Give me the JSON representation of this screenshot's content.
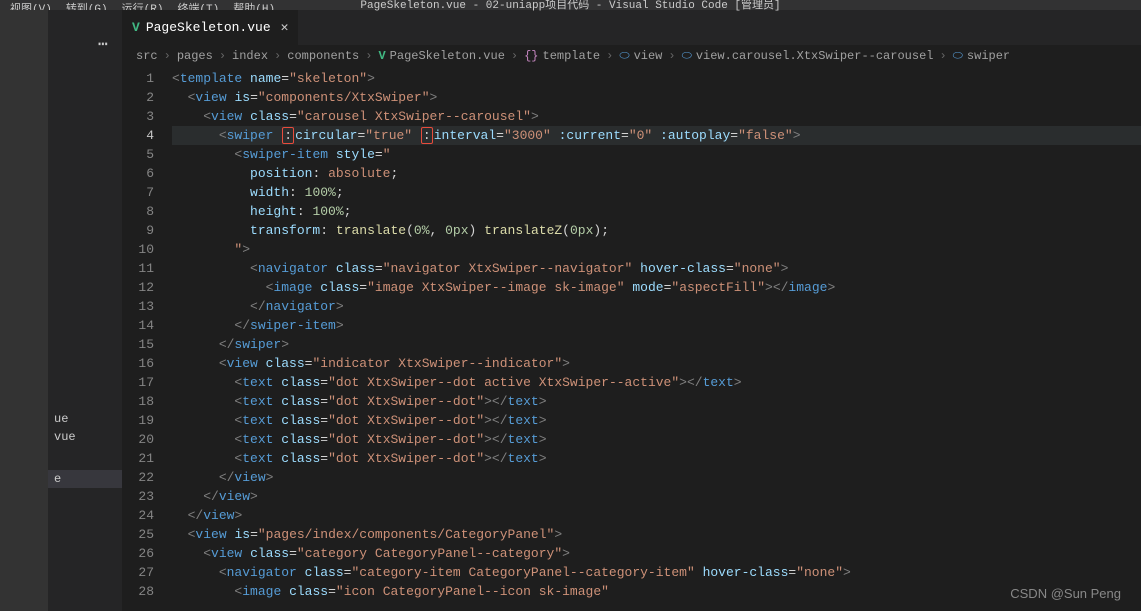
{
  "title": "PageSkeleton.vue - 02-uniapp项目代码 - Visual Studio Code [管理员]",
  "menu": [
    "视图(V)",
    "转到(G)",
    "运行(R)",
    "终端(T)",
    "帮助(H)"
  ],
  "tab": {
    "filename": "PageSkeleton.vue"
  },
  "breadcrumbs": [
    "src",
    "pages",
    "index",
    "components",
    "PageSkeleton.vue",
    "template",
    "view",
    "view.carousel.XtxSwiper--carousel",
    "swiper"
  ],
  "sidebar": {
    "items": [
      "ue",
      "vue",
      "e"
    ]
  },
  "gutter": {
    "start": 1,
    "end": 28,
    "current": 4
  },
  "code": {
    "l1": {
      "tag": "template",
      "attr": "name",
      "val": "skeleton"
    },
    "l2": {
      "tag": "view",
      "attr": "is",
      "val": "components/XtxSwiper"
    },
    "l3": {
      "tag": "view",
      "attr": "class",
      "val": "carousel XtxSwiper--carousel"
    },
    "l4": {
      "tag": "swiper",
      "a1": "circular",
      "v1": "true",
      "a2": "interval",
      "v2": "3000",
      "a3": ":current",
      "v3": "0",
      "a4": ":autoplay",
      "v4": "false"
    },
    "l5": {
      "tag": "swiper-item",
      "attr": "style"
    },
    "l6": {
      "prop": "position",
      "val": "absolute"
    },
    "l7": {
      "prop": "width",
      "val": "100%"
    },
    "l8": {
      "prop": "height",
      "val": "100%"
    },
    "l9": {
      "prop": "transform",
      "fn": "translate",
      "a1": "0%",
      "a2": "0px",
      "fn2": "translateZ",
      "a3": "0px"
    },
    "l11": {
      "tag": "navigator",
      "attr": "class",
      "val": "navigator XtxSwiper--navigator",
      "attr2": "hover-class",
      "val2": "none"
    },
    "l12": {
      "tag": "image",
      "attr": "class",
      "val": "image XtxSwiper--image sk-image",
      "attr2": "mode",
      "val2": "aspectFill"
    },
    "l13": {
      "tag": "navigator"
    },
    "l14": {
      "tag": "swiper-item"
    },
    "l15": {
      "tag": "swiper"
    },
    "l16": {
      "tag": "view",
      "attr": "class",
      "val": "indicator XtxSwiper--indicator"
    },
    "l17": {
      "tag": "text",
      "attr": "class",
      "val": "dot XtxSwiper--dot active XtxSwiper--active"
    },
    "l18": {
      "tag": "text",
      "attr": "class",
      "val": "dot XtxSwiper--dot"
    },
    "l22": {
      "tag": "view"
    },
    "l23": {
      "tag": "view"
    },
    "l24": {
      "tag": "view"
    },
    "l25": {
      "tag": "view",
      "attr": "is",
      "val": "pages/index/components/CategoryPanel"
    },
    "l26": {
      "tag": "view",
      "attr": "class",
      "val": "category CategoryPanel--category"
    },
    "l27": {
      "tag": "navigator",
      "attr": "class",
      "val": "category-item CategoryPanel--category-item",
      "attr2": "hover-class",
      "val2": "none"
    },
    "l28": {
      "tag": "image",
      "attr": "class",
      "val": "icon CategoryPanel--icon sk-image"
    }
  },
  "watermark": "CSDN @Sun Peng"
}
